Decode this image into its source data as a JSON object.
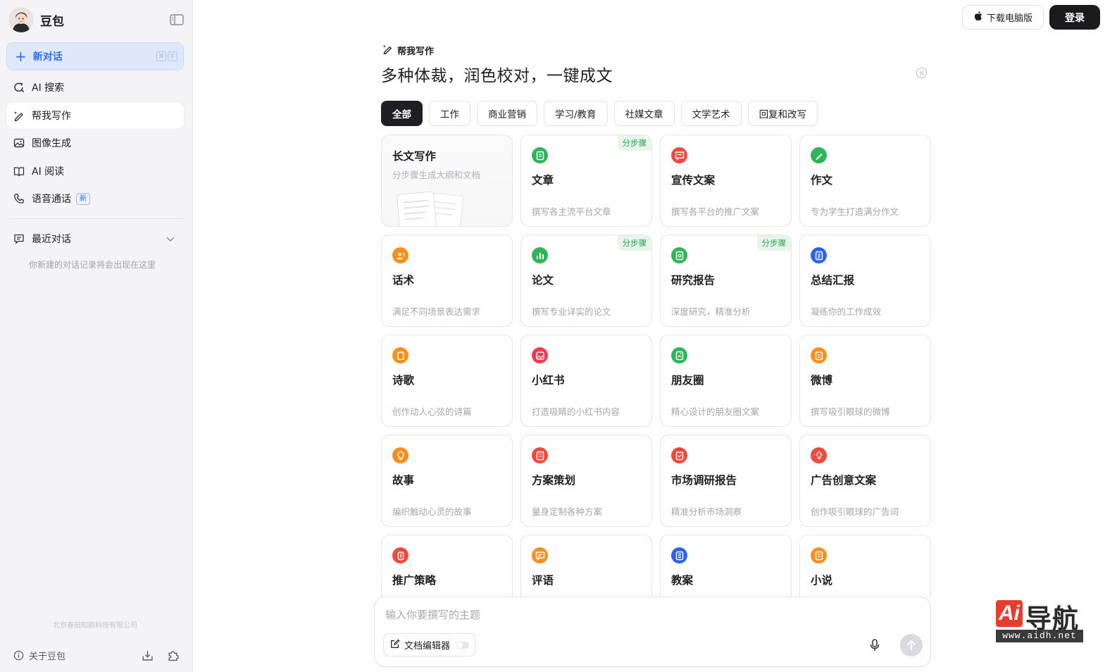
{
  "sidebar": {
    "brand": "豆包",
    "new_chat": {
      "label": "新对话",
      "shortcut": [
        "⌘",
        "K"
      ]
    },
    "nav": [
      {
        "label": "AI 搜索",
        "icon": "search-refresh-icon"
      },
      {
        "label": "帮我写作",
        "icon": "pen-sparkle-icon",
        "active": true
      },
      {
        "label": "图像生成",
        "icon": "image-icon"
      },
      {
        "label": "AI 阅读",
        "icon": "book-icon"
      },
      {
        "label": "语音通话",
        "icon": "phone-icon",
        "badge": "新"
      }
    ],
    "recent": {
      "label": "最近对话",
      "empty_hint": "你新建的对话记录将会出现在这里"
    },
    "company": "北京春田知韵科技有限公司",
    "about": "关于豆包"
  },
  "topbar": {
    "download_label": "下载电脑版",
    "login_label": "登录"
  },
  "header": {
    "tool_label": "帮我写作",
    "headline": "多种体裁，润色校对，一键成文"
  },
  "filters": [
    "全部",
    "工作",
    "商业营销",
    "学习/教育",
    "社媒文章",
    "文学艺术",
    "回复和改写"
  ],
  "cards": [
    {
      "title": "长文写作",
      "desc": "分步骤生成大纲和文档",
      "type": "long"
    },
    {
      "title": "文章",
      "desc": "撰写各主流平台文章",
      "color": "#2fb45a",
      "icon": "article-icon",
      "tag": "分步骤"
    },
    {
      "title": "宣传文案",
      "desc": "撰写各平台的推广文案",
      "color": "#f04a3e",
      "icon": "chat-bubble-icon"
    },
    {
      "title": "作文",
      "desc": "专为学生打造满分作文",
      "color": "#2fb45a",
      "icon": "pencil-icon"
    },
    {
      "title": "话术",
      "desc": "满足不同场景表达需求",
      "color": "#f5901f",
      "icon": "person-talk-icon"
    },
    {
      "title": "论文",
      "desc": "撰写专业详实的论文",
      "color": "#2fb45a",
      "icon": "bar-chart-icon",
      "tag": "分步骤"
    },
    {
      "title": "研究报告",
      "desc": "深度研究，精准分析",
      "color": "#2fb45a",
      "icon": "report-icon",
      "tag": "分步骤"
    },
    {
      "title": "总结汇报",
      "desc": "凝练你的工作成效",
      "color": "#2d63e8",
      "icon": "document-icon"
    },
    {
      "title": "诗歌",
      "desc": "创作动人心弦的诗篇",
      "color": "#f5901f",
      "icon": "notepad-icon"
    },
    {
      "title": "小红书",
      "desc": "打造吸睛的小红书内容",
      "color": "#f03a52",
      "icon": "photo-post-icon"
    },
    {
      "title": "朋友圈",
      "desc": "精心设计的朋友圈文案",
      "color": "#2fb45a",
      "icon": "moments-icon"
    },
    {
      "title": "微博",
      "desc": "撰写吸引眼球的微博",
      "color": "#f5901f",
      "icon": "weibo-icon"
    },
    {
      "title": "故事",
      "desc": "编织触动心灵的故事",
      "color": "#f5901f",
      "icon": "lightbulb-icon"
    },
    {
      "title": "方案策划",
      "desc": "量身定制各种方案",
      "color": "#f04a3e",
      "icon": "plan-icon"
    },
    {
      "title": "市场调研报告",
      "desc": "精准分析市场洞察",
      "color": "#f04a3e",
      "icon": "survey-icon"
    },
    {
      "title": "广告创意文案",
      "desc": "创作吸引眼球的广告词",
      "color": "#f04a3e",
      "icon": "idea-bulb-icon"
    },
    {
      "title": "推广策略",
      "desc": "",
      "color": "#f04a3e",
      "icon": "strategy-icon"
    },
    {
      "title": "评语",
      "desc": "",
      "color": "#f5901f",
      "icon": "comment-icon"
    },
    {
      "title": "教案",
      "desc": "",
      "color": "#2d63e8",
      "icon": "lesson-icon"
    },
    {
      "title": "小说",
      "desc": "",
      "color": "#f5901f",
      "icon": "novel-icon"
    }
  ],
  "input": {
    "placeholder": "输入你要撰写的主题",
    "doc_editor_label": "文档编辑器"
  },
  "watermark": {
    "logo_text": "Ai",
    "name": "导航",
    "url": "www.aidh.net"
  }
}
